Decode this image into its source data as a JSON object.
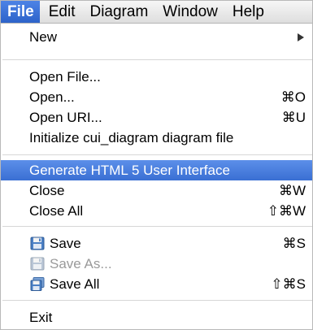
{
  "menubar": {
    "items": [
      "File",
      "Edit",
      "Diagram",
      "Window",
      "Help"
    ]
  },
  "menu": {
    "new_label": "New",
    "open_file_label": "Open File...",
    "open_label": "Open...",
    "open_shortcut": "⌘O",
    "open_uri_label": "Open URI...",
    "open_uri_shortcut": "⌘U",
    "initialize_label": "Initialize cui_diagram diagram file",
    "generate_label": "Generate HTML 5 User Interface",
    "close_label": "Close",
    "close_shortcut": "⌘W",
    "close_all_label": "Close All",
    "close_all_shortcut": "⇧⌘W",
    "save_label": "Save",
    "save_shortcut": "⌘S",
    "save_as_label": "Save As...",
    "save_all_label": "Save All",
    "save_all_shortcut": "⇧⌘S",
    "exit_label": "Exit"
  },
  "icons": {
    "save": "floppy-disk-icon",
    "save_as": "floppy-disk-icon",
    "save_all": "floppy-disk-stack-icon"
  },
  "colors": {
    "highlight": "#3a6fd3",
    "disabled_text": "#9a9a9a"
  }
}
